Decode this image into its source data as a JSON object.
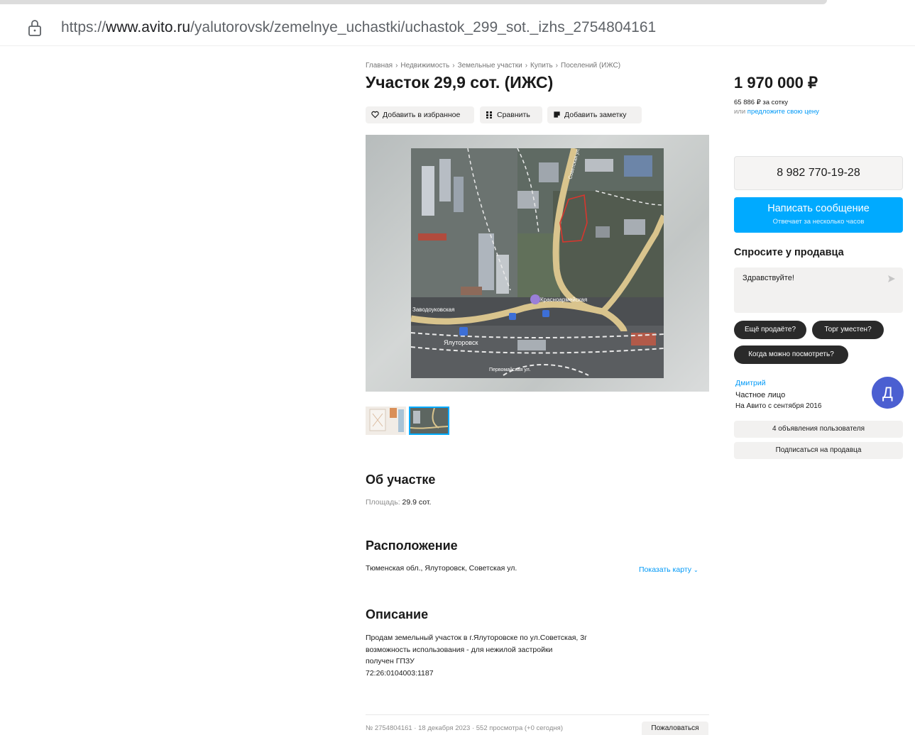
{
  "browser": {
    "url_prefix": "https://",
    "url_domain": "www.avito.ru",
    "url_path": "/yalutorovsk/zemelnye_uchastki/uchastok_299_sot._izhs_2754804161"
  },
  "breadcrumbs": [
    "Главная",
    "Недвижимость",
    "Земельные участки",
    "Купить",
    "Поселений (ИЖС)"
  ],
  "breadcrumb_separator": "›",
  "title": "Участок 29,9 сот. (ИЖС)",
  "actions": {
    "favorite": "Добавить в избранное",
    "compare": "Сравнить",
    "note": "Добавить заметку"
  },
  "map_labels": {
    "station": "Ялуторовск",
    "street_west": "Заводоуковская",
    "street_east": "Красноармейская",
    "street_north": "Советская ул.",
    "street_bottom": "Первомайская ул."
  },
  "about": {
    "heading": "Об участке",
    "area_label": "Площадь:",
    "area_value": " 29.9 сот."
  },
  "location": {
    "heading": "Расположение",
    "address": "Тюменская обл., Ялуторовск, Советская ул.",
    "show_map": "Показать карту"
  },
  "description": {
    "heading": "Описание",
    "lines": [
      "Продам земельный участок в г.Ялуторовске по ул.Советская, 3г",
      "возможность использования - для нежилой застройки",
      "получен ГПЗУ",
      "72:26:0104003:1187"
    ]
  },
  "footer": {
    "meta": "№ 2754804161 · 18 декабря 2023 · 552 просмотра (+0 сегодня)",
    "complain": "Пожаловаться"
  },
  "sidebar": {
    "price": "1 970 000 ₽",
    "per_sotka": "65 886 ₽ за сотку",
    "offer_prefix": "или ",
    "offer_link": "предложите свою цену",
    "phone": "8 982 770-19-28",
    "message_button": "Написать сообщение",
    "message_sub": "Отвечает за несколько часов",
    "ask_heading": "Спросите у продавца",
    "ask_placeholder": "Здравствуйте!",
    "chips": [
      "Ещё продаёте?",
      "Торг уместен?",
      "Когда можно посмотреть?"
    ],
    "seller_name": "Дмитрий",
    "seller_type": "Частное лицо",
    "seller_since": "На Авито с сентября 2016",
    "avatar_letter": "Д",
    "listings_button": "4 объявления пользователя",
    "subscribe_button": "Подписаться на продавца"
  },
  "colors": {
    "accent_blue": "#00aaff",
    "link_blue": "#0099f7",
    "avatar_bg": "#4b5fd1",
    "chip_bg": "#2a2a2a"
  }
}
